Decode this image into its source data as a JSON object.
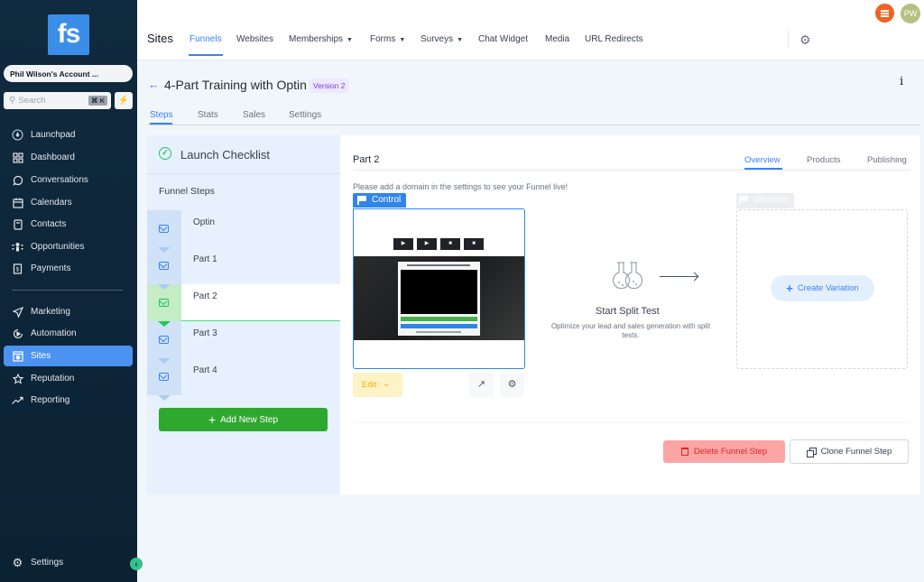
{
  "sidebar": {
    "logo": "fs",
    "account": "Phil Wilson's Account ...",
    "search_placeholder": "Search",
    "search_shortcut": "⌘ K",
    "items": [
      {
        "label": "Launchpad",
        "icon": "rocket-icon"
      },
      {
        "label": "Dashboard",
        "icon": "dashboard-icon"
      },
      {
        "label": "Conversations",
        "icon": "chat-icon"
      },
      {
        "label": "Calendars",
        "icon": "calendar-icon"
      },
      {
        "label": "Contacts",
        "icon": "contacts-icon"
      },
      {
        "label": "Opportunities",
        "icon": "opportunities-icon"
      },
      {
        "label": "Payments",
        "icon": "payments-icon"
      },
      {
        "label": "Marketing",
        "icon": "send-icon"
      },
      {
        "label": "Automation",
        "icon": "automation-icon"
      },
      {
        "label": "Sites",
        "icon": "sites-icon",
        "active": true
      },
      {
        "label": "Reputation",
        "icon": "star-icon"
      },
      {
        "label": "Reporting",
        "icon": "trend-icon"
      }
    ],
    "settings": "Settings"
  },
  "topbar": {
    "title": "Sites",
    "nav": [
      {
        "label": "Funnels",
        "active": true
      },
      {
        "label": "Websites"
      },
      {
        "label": "Memberships",
        "dropdown": true
      },
      {
        "label": "Forms",
        "dropdown": true
      },
      {
        "label": "Surveys",
        "dropdown": true
      },
      {
        "label": "Chat Widget"
      },
      {
        "label": "Media"
      },
      {
        "label": "URL Redirects"
      }
    ],
    "avatar_initials": "PW"
  },
  "header": {
    "title": "4-Part Training with Optin",
    "version": "Version 2",
    "tabs": [
      "Steps",
      "Stats",
      "Sales",
      "Settings"
    ],
    "active_tab": "Steps"
  },
  "steps_panel": {
    "checklist": "Launch Checklist",
    "heading": "Funnel Steps",
    "steps": [
      "Optin",
      "Part 1",
      "Part 2",
      "Part 3",
      "Part 4"
    ],
    "active_step": "Part 2",
    "add_button": "Add New Step"
  },
  "main": {
    "step_title": "Part 2",
    "tabs": [
      "Overview",
      "Products",
      "Publishing"
    ],
    "active_tab": "Overview",
    "notice": "Please add a domain in the settings to see your Funnel live!",
    "control_label": "Control",
    "edit_label": "Edit",
    "split_test_title": "Start Split Test",
    "split_test_desc": "Optimize your lead and sales generation with split tests.",
    "variation_label": "Variation",
    "create_variation": "Create Variation",
    "delete_button": "Delete Funnel Step",
    "clone_button": "Clone Funnel Step"
  },
  "colors": {
    "sidebar_bg": "#0d2538",
    "accent": "#3b82f6",
    "active_nav": "#4c92f0",
    "success": "#2fa82f",
    "danger_bg": "#fca5a5",
    "danger_text": "#dc2626",
    "notification": "#f06222"
  }
}
